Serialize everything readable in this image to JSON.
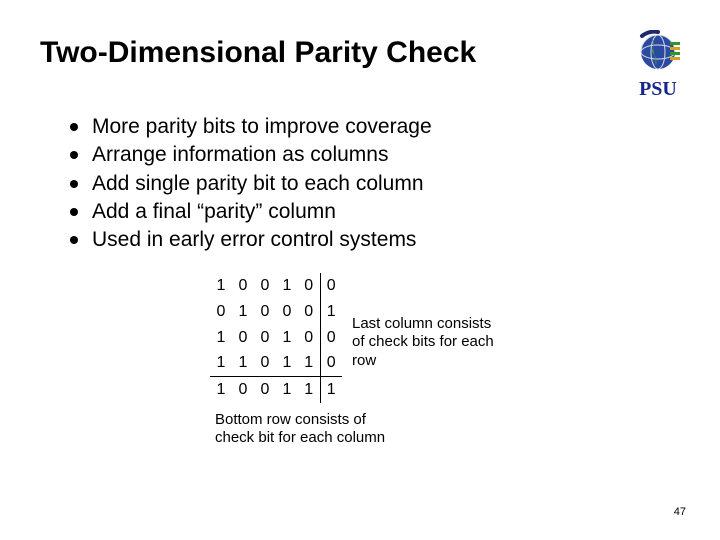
{
  "title": "Two-Dimensional Parity Check",
  "logo_label": "PSU",
  "bullets": [
    "More parity bits to improve coverage",
    "Arrange information as columns",
    "Add single parity bit to each column",
    "Add a final “parity” column",
    "Used in early error control systems"
  ],
  "matrix": [
    [
      "1",
      "0",
      "0",
      "1",
      "0",
      "0"
    ],
    [
      "0",
      "1",
      "0",
      "0",
      "0",
      "1"
    ],
    [
      "1",
      "0",
      "0",
      "1",
      "0",
      "0"
    ],
    [
      "1",
      "1",
      "0",
      "1",
      "1",
      "0"
    ],
    [
      "1",
      "0",
      "0",
      "1",
      "1",
      "1"
    ]
  ],
  "side_note_lines": [
    "Last column consists",
    "of check bits for each",
    "row"
  ],
  "bottom_note_lines": [
    "Bottom row consists of",
    "check bit for each column"
  ],
  "page_number": "47"
}
